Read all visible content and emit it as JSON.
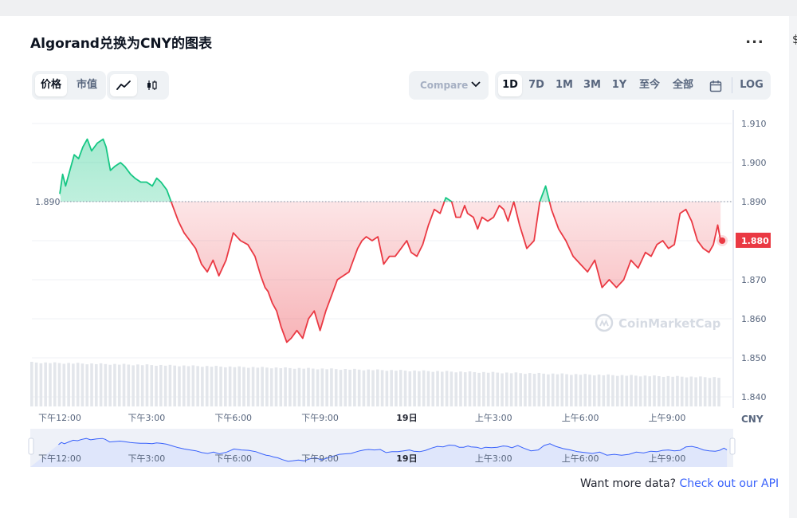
{
  "title": "Algorand兑换为CNY的图表",
  "more_label": "...",
  "edge_glyph": "$",
  "type_tabs": [
    {
      "label": "价格",
      "active": true
    },
    {
      "label": "市值",
      "active": false
    }
  ],
  "style_tabs": [
    {
      "icon": "line-chart-icon",
      "active": true
    },
    {
      "icon": "candlestick-icon",
      "active": false
    }
  ],
  "compare_label": "Compare",
  "range_tabs": [
    {
      "label": "1D",
      "active": true
    },
    {
      "label": "7D",
      "active": false
    },
    {
      "label": "1M",
      "active": false
    },
    {
      "label": "3M",
      "active": false
    },
    {
      "label": "1Y",
      "active": false
    },
    {
      "label": "至今",
      "active": false
    },
    {
      "label": "全部",
      "active": false
    }
  ],
  "log_label": "LOG",
  "watermark": "CoinMarketCap",
  "api": {
    "prefix": "Want more data? ",
    "link": "Check out our API"
  },
  "colors": {
    "up": "#16c784",
    "down": "#ea3943",
    "accent": "#3861fb",
    "nav_fill": "#dfe6fb",
    "nav_line": "#3861fb"
  },
  "chart_data": {
    "type": "line",
    "currency": "CNY",
    "baseline": 1.89,
    "baseline_label": "1.890",
    "current_label": "1.880",
    "y_ticks": [
      "1.910",
      "1.900",
      "1.890",
      "1.880",
      "1.870",
      "1.860",
      "1.850",
      "1.840"
    ],
    "y_tick_values": [
      1.91,
      1.9,
      1.89,
      1.88,
      1.87,
      1.86,
      1.85,
      1.84
    ],
    "ylim": [
      1.8365,
      1.9165
    ],
    "x_ticks": [
      "下午12:00",
      "下午3:00",
      "下午6:00",
      "下午9:00",
      "19日",
      "上午3:00",
      "上午6:00",
      "上午9:00"
    ],
    "x_tick_hours": [
      0,
      3,
      6,
      9,
      12,
      15,
      18,
      21
    ],
    "x_range_hours": [
      -0.4,
      23.6
    ],
    "x": [
      0,
      0.1,
      0.2,
      0.35,
      0.5,
      0.65,
      0.8,
      0.95,
      1.1,
      1.3,
      1.5,
      1.6,
      1.75,
      1.9,
      2.1,
      2.25,
      2.45,
      2.6,
      2.8,
      3.0,
      3.2,
      3.35,
      3.5,
      3.7,
      3.9,
      4.1,
      4.3,
      4.5,
      4.7,
      4.9,
      5.1,
      5.3,
      5.5,
      5.75,
      6.0,
      6.25,
      6.5,
      6.75,
      6.95,
      7.1,
      7.2,
      7.35,
      7.5,
      7.65,
      7.85,
      8.0,
      8.2,
      8.4,
      8.6,
      8.8,
      9.0,
      9.2,
      9.4,
      9.6,
      9.8,
      10.0,
      10.15,
      10.3,
      10.45,
      10.6,
      10.8,
      11.0,
      11.2,
      11.4,
      11.6,
      11.8,
      12.0,
      12.15,
      12.35,
      12.55,
      12.75,
      12.95,
      13.15,
      13.35,
      13.55,
      13.7,
      13.85,
      14.0,
      14.1,
      14.3,
      14.45,
      14.6,
      14.8,
      15.0,
      15.2,
      15.35,
      15.5,
      15.7,
      15.9,
      16.15,
      16.4,
      16.6,
      16.8,
      17.0,
      17.25,
      17.5,
      17.75,
      18.0,
      18.25,
      18.5,
      18.75,
      19.0,
      19.25,
      19.5,
      19.75,
      20.0,
      20.25,
      20.45,
      20.65,
      20.85,
      21.05,
      21.25,
      21.45,
      21.65,
      21.85,
      22.05,
      22.25,
      22.45,
      22.6,
      22.75,
      22.85
    ],
    "y": [
      1.892,
      1.897,
      1.894,
      1.898,
      1.902,
      1.901,
      1.904,
      1.906,
      1.903,
      1.905,
      1.906,
      1.904,
      1.898,
      1.899,
      1.9,
      1.899,
      1.897,
      1.896,
      1.895,
      1.895,
      1.894,
      1.896,
      1.895,
      1.893,
      1.889,
      1.885,
      1.882,
      1.88,
      1.878,
      1.874,
      1.872,
      1.875,
      1.871,
      1.875,
      1.882,
      1.88,
      1.879,
      1.876,
      1.871,
      1.868,
      1.867,
      1.864,
      1.862,
      1.858,
      1.854,
      1.855,
      1.857,
      1.855,
      1.86,
      1.862,
      1.857,
      1.862,
      1.866,
      1.87,
      1.871,
      1.872,
      1.875,
      1.878,
      1.88,
      1.881,
      1.88,
      1.881,
      1.874,
      1.876,
      1.876,
      1.878,
      1.88,
      1.877,
      1.876,
      1.879,
      1.884,
      1.888,
      1.887,
      1.891,
      1.89,
      1.886,
      1.886,
      1.889,
      1.887,
      1.886,
      1.883,
      1.886,
      1.885,
      1.886,
      1.889,
      1.888,
      1.885,
      1.89,
      1.884,
      1.878,
      1.88,
      1.89,
      1.894,
      1.888,
      1.883,
      1.88,
      1.876,
      1.874,
      1.872,
      1.875,
      1.868,
      1.87,
      1.868,
      1.87,
      1.875,
      1.873,
      1.877,
      1.876,
      1.879,
      1.88,
      1.878,
      1.879,
      1.887,
      1.888,
      1.885,
      1.88,
      1.878,
      1.877,
      1.879,
      1.884,
      1.88
    ],
    "x_label": "",
    "y_label": "CNY",
    "grid": true,
    "legend": "none"
  }
}
